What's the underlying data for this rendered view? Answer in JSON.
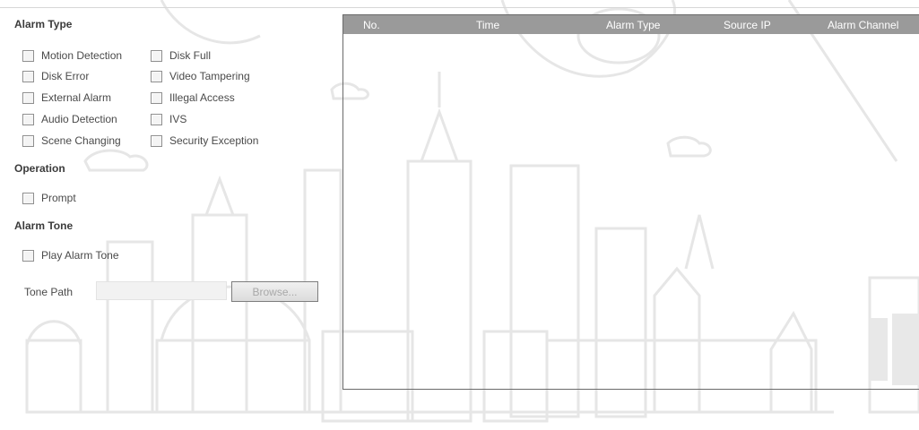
{
  "alarm_type": {
    "title": "Alarm Type",
    "options": [
      "Motion Detection",
      "Disk Full",
      "Disk Error",
      "Video Tampering",
      "External Alarm",
      "Illegal Access",
      "Audio Detection",
      "IVS",
      "Scene Changing",
      "Security Exception"
    ]
  },
  "operation": {
    "title": "Operation",
    "prompt": "Prompt"
  },
  "alarm_tone": {
    "title": "Alarm Tone",
    "play": "Play Alarm Tone",
    "path_label": "Tone Path",
    "path_value": "",
    "browse": "Browse..."
  },
  "table": {
    "columns": [
      "No.",
      "Time",
      "Alarm Type",
      "Source IP",
      "Alarm Channel"
    ],
    "rows": []
  },
  "colors": {
    "header_bg": "#9a9a9a",
    "watermark": "#ececec"
  }
}
